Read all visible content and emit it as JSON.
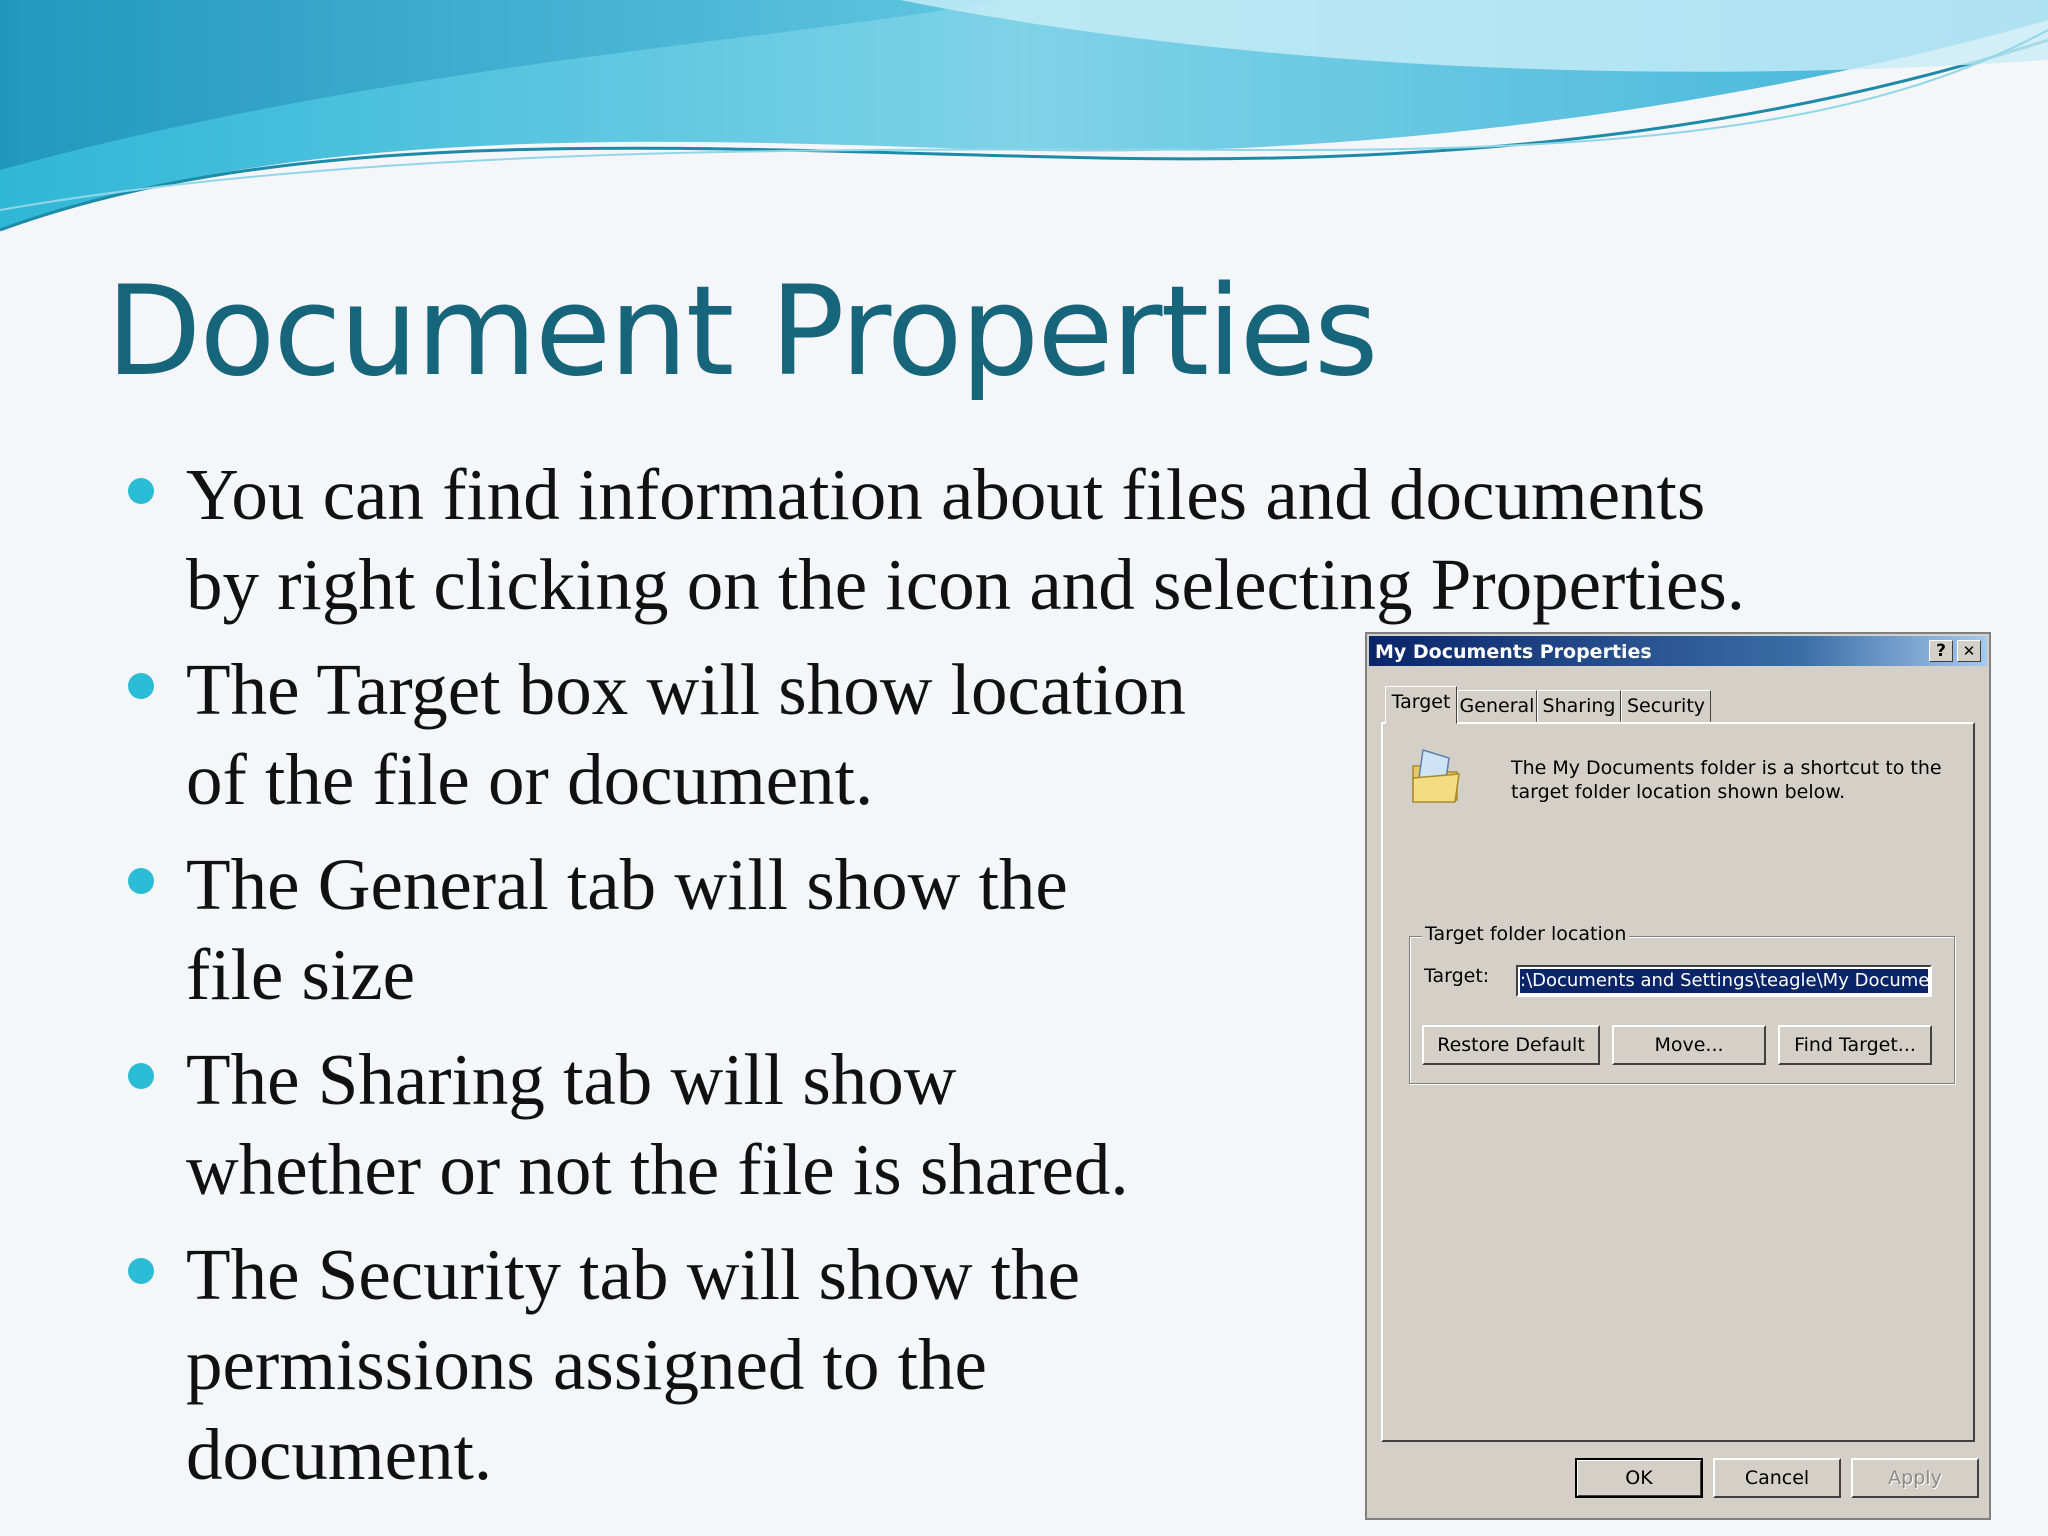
{
  "slide": {
    "title": "Document Properties",
    "bullets": [
      [
        "You can find information about files and documents",
        "by right clicking on the icon and selecting Properties."
      ],
      [
        "The Target box will show location",
        "of the file or document."
      ],
      [
        "The General tab will show the",
        "file size"
      ],
      [
        "The Sharing tab will show",
        "whether or not the file is shared."
      ],
      [
        "The Security tab will show the",
        "permissions assigned to the",
        "document."
      ]
    ]
  },
  "dialog": {
    "title": "My Documents Properties",
    "help_glyph": "?",
    "close_glyph": "✕",
    "tabs": [
      "Target",
      "General",
      "Sharing",
      "Security"
    ],
    "description": "The My Documents folder is a shortcut to the target folder location shown below.",
    "group_label": "Target folder location",
    "target_label": "Target:",
    "target_value": ":\\Documents and Settings\\teagle\\My Documents",
    "buttons": {
      "restore_default": "Restore Default",
      "move": "Move...",
      "find_target": "Find Target...",
      "ok": "OK",
      "cancel": "Cancel",
      "apply": "Apply"
    }
  },
  "colors": {
    "title": "#17657a",
    "bullet": "#2bbcd6",
    "dialog_face": "#d4d0c8",
    "titlebar": "#0a246a"
  }
}
